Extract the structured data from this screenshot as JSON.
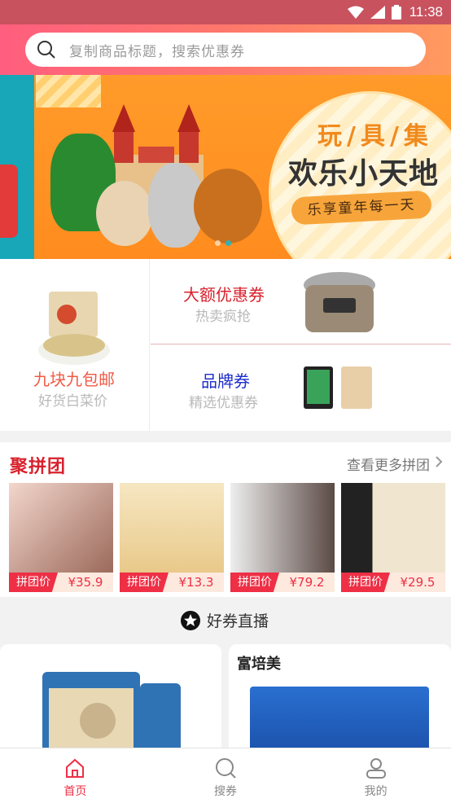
{
  "status_bar": {
    "time": "11:38"
  },
  "search": {
    "placeholder": "复制商品标题，搜索优惠券"
  },
  "banner": {
    "title_small": "玩/具/集",
    "title_big": "欢乐小天地",
    "pill_text": "乐享童年每一天",
    "slide_count": 2,
    "active_slide": 2
  },
  "promo": {
    "left": {
      "title": "九块九包邮",
      "subtitle": "好货白菜价",
      "title_color": "#f05a45"
    },
    "right_top": {
      "title": "大额优惠券",
      "subtitle": "热卖疯抢",
      "title_color": "#d8212d"
    },
    "right_bottom": {
      "title": "品牌券",
      "subtitle": "精选优惠券",
      "title_color": "#1f2fcc"
    }
  },
  "group_buy": {
    "title": "聚拼团",
    "more_label": "查看更多拼团",
    "items": [
      {
        "label": "拼团价",
        "price": "¥35.9"
      },
      {
        "label": "拼团价",
        "price": "¥13.3"
      },
      {
        "label": "拼团价",
        "price": "¥79.2"
      },
      {
        "label": "拼团价",
        "price": "¥29.5"
      }
    ]
  },
  "coupon_live": {
    "title": "好券直播"
  },
  "feed": {
    "right_card_brand": "富培美"
  },
  "tabbar": {
    "items": [
      {
        "label": "首页",
        "icon": "home-icon",
        "active": true
      },
      {
        "label": "搜券",
        "icon": "search-icon",
        "active": false
      },
      {
        "label": "我的",
        "icon": "user-icon",
        "active": false
      }
    ]
  },
  "colors": {
    "accent": "#ee2f45",
    "header_start": "#ff5e7e",
    "header_end": "#ff9a60"
  }
}
